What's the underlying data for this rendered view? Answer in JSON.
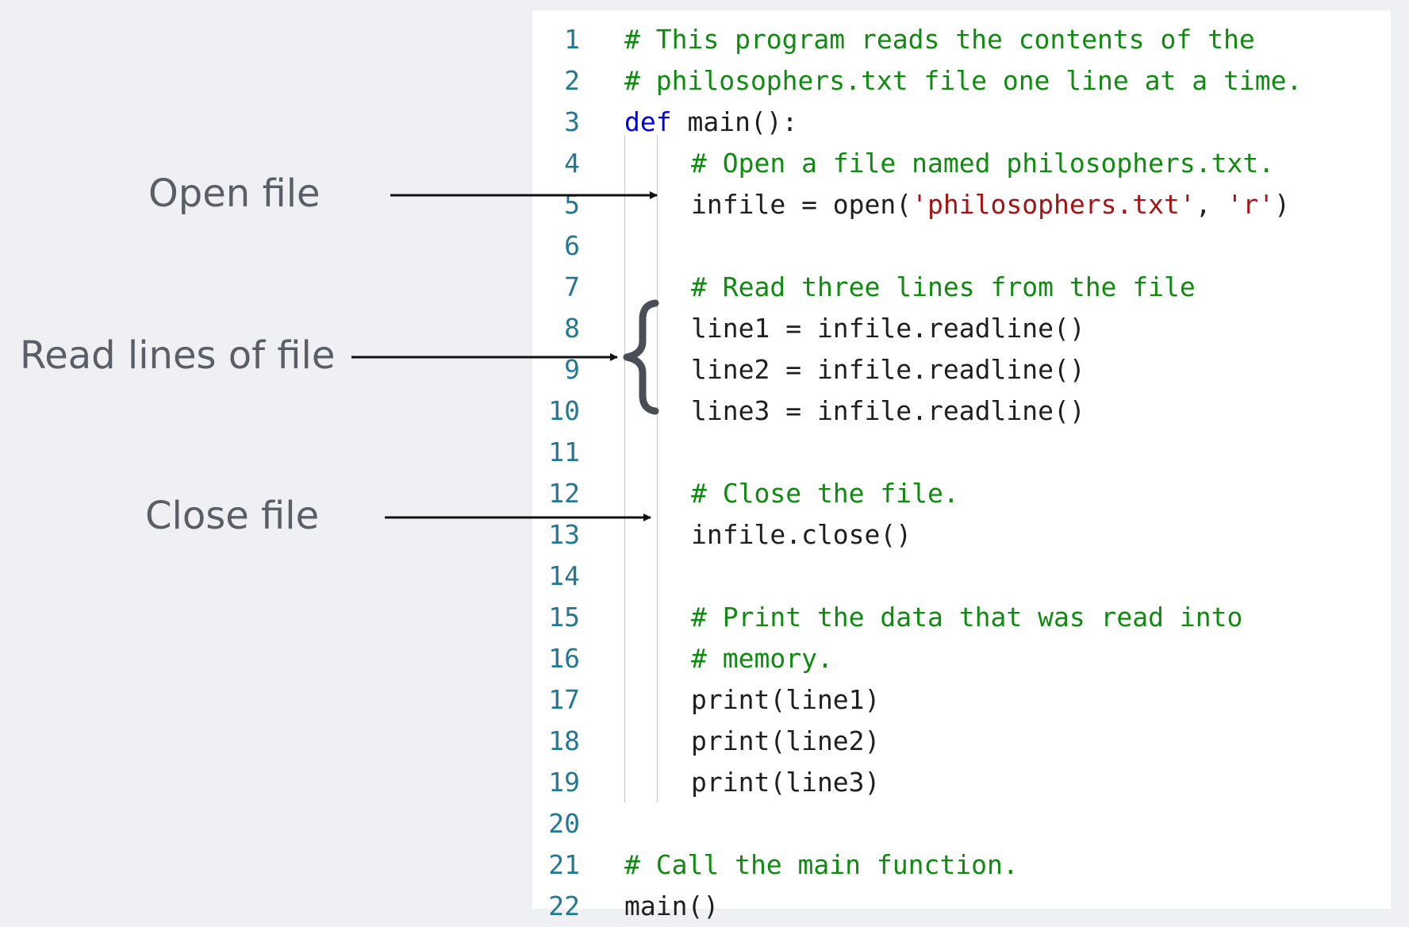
{
  "annotations": {
    "open_file": "Open file",
    "read_lines": "Read lines of file",
    "close_file": "Close file"
  },
  "code": [
    {
      "n": "1",
      "indent": 0,
      "tokens": [
        {
          "t": "comment",
          "v": "# This program reads the contents of the"
        }
      ]
    },
    {
      "n": "2",
      "indent": 0,
      "tokens": [
        {
          "t": "comment",
          "v": "# philosophers.txt file one line at a time."
        }
      ]
    },
    {
      "n": "3",
      "indent": 0,
      "tokens": [
        {
          "t": "keyword",
          "v": "def"
        },
        {
          "t": "plain",
          "v": " main():"
        }
      ]
    },
    {
      "n": "4",
      "indent": 1,
      "tokens": [
        {
          "t": "comment",
          "v": "# Open a file named philosophers.txt."
        }
      ]
    },
    {
      "n": "5",
      "indent": 1,
      "tokens": [
        {
          "t": "plain",
          "v": "infile = open("
        },
        {
          "t": "string",
          "v": "'philosophers.txt'"
        },
        {
          "t": "plain",
          "v": ", "
        },
        {
          "t": "string",
          "v": "'r'"
        },
        {
          "t": "plain",
          "v": ")"
        }
      ]
    },
    {
      "n": "6",
      "indent": 1,
      "tokens": []
    },
    {
      "n": "7",
      "indent": 1,
      "tokens": [
        {
          "t": "comment",
          "v": "# Read three lines from the file"
        }
      ]
    },
    {
      "n": "8",
      "indent": 1,
      "tokens": [
        {
          "t": "plain",
          "v": "line1 = infile.readline()"
        }
      ]
    },
    {
      "n": "9",
      "indent": 1,
      "tokens": [
        {
          "t": "plain",
          "v": "line2 = infile.readline()"
        }
      ]
    },
    {
      "n": "10",
      "indent": 1,
      "tokens": [
        {
          "t": "plain",
          "v": "line3 = infile.readline()"
        }
      ]
    },
    {
      "n": "11",
      "indent": 1,
      "tokens": []
    },
    {
      "n": "12",
      "indent": 1,
      "tokens": [
        {
          "t": "comment",
          "v": "# Close the file."
        }
      ]
    },
    {
      "n": "13",
      "indent": 1,
      "tokens": [
        {
          "t": "plain",
          "v": "infile.close()"
        }
      ]
    },
    {
      "n": "14",
      "indent": 1,
      "tokens": []
    },
    {
      "n": "15",
      "indent": 1,
      "tokens": [
        {
          "t": "comment",
          "v": "# Print the data that was read into"
        }
      ]
    },
    {
      "n": "16",
      "indent": 1,
      "tokens": [
        {
          "t": "comment",
          "v": "# memory."
        }
      ]
    },
    {
      "n": "17",
      "indent": 1,
      "tokens": [
        {
          "t": "plain",
          "v": "print(line1)"
        }
      ]
    },
    {
      "n": "18",
      "indent": 1,
      "tokens": [
        {
          "t": "plain",
          "v": "print(line2)"
        }
      ]
    },
    {
      "n": "19",
      "indent": 1,
      "tokens": [
        {
          "t": "plain",
          "v": "print(line3)"
        }
      ]
    },
    {
      "n": "20",
      "indent": 0,
      "tokens": []
    },
    {
      "n": "21",
      "indent": 0,
      "tokens": [
        {
          "t": "comment",
          "v": "# Call the main function."
        }
      ]
    },
    {
      "n": "22",
      "indent": 0,
      "tokens": [
        {
          "t": "plain",
          "v": "main()"
        }
      ]
    }
  ],
  "colors": {
    "line_number": "#237893",
    "comment": "#108a10",
    "keyword": "#0000ee",
    "string": "#a31515",
    "plain": "#1f1f1f",
    "annotation_text": "#5a5e66",
    "arrow": "#111111",
    "brace": "#4a4e56"
  }
}
